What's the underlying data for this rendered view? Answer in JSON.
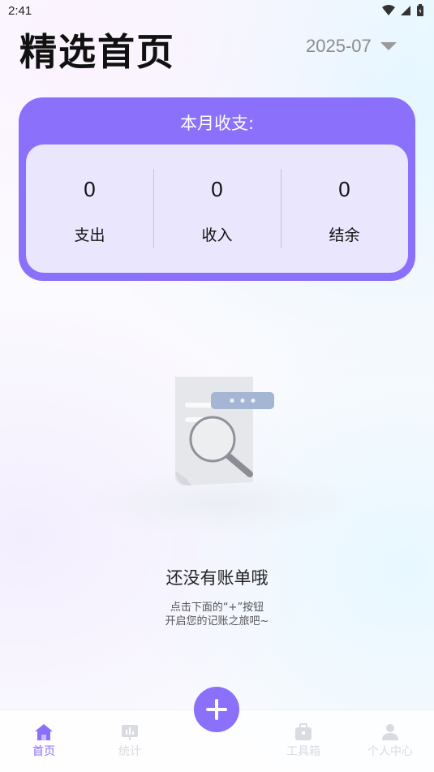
{
  "status_bar": {
    "time": "2:41"
  },
  "header": {
    "title": "精选首页",
    "month": "2025-07"
  },
  "summary": {
    "title": "本月收支:",
    "items": [
      {
        "value": "0",
        "label": "支出"
      },
      {
        "value": "0",
        "label": "收入"
      },
      {
        "value": "0",
        "label": "结余"
      }
    ]
  },
  "empty_state": {
    "title": "还没有账单哦",
    "hint_line1": "点击下面的“+”按钮",
    "hint_line2": "开启您的记账之旅吧~"
  },
  "nav": {
    "items": [
      {
        "label": "首页",
        "icon": "home-icon",
        "active": true
      },
      {
        "label": "统计",
        "icon": "chart-icon",
        "active": false
      },
      {
        "label": "工具箱",
        "icon": "toolbox-icon",
        "active": false
      },
      {
        "label": "个人中心",
        "icon": "person-icon",
        "active": false
      }
    ]
  },
  "colors": {
    "accent": "#8a70fb",
    "card_inner": "#e9e6fd",
    "inactive": "#d9dbe2"
  }
}
